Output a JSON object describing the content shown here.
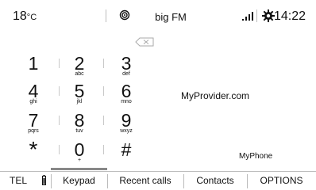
{
  "status": {
    "temperature": "18",
    "temperature_unit": "°C",
    "station": "big FM",
    "clock": "14:22",
    "icons": {
      "radio": "radio-source-icon",
      "signal": "signal-strength-icon",
      "settings": "gear-icon"
    }
  },
  "keypad": {
    "keys": [
      {
        "digit": "1",
        "letters": ""
      },
      {
        "digit": "2",
        "letters": "abc"
      },
      {
        "digit": "3",
        "letters": "def"
      },
      {
        "digit": "4",
        "letters": "ghi"
      },
      {
        "digit": "5",
        "letters": "jkl"
      },
      {
        "digit": "6",
        "letters": "mno"
      },
      {
        "digit": "7",
        "letters": "pqrs"
      },
      {
        "digit": "8",
        "letters": "tuv"
      },
      {
        "digit": "9",
        "letters": "wxyz"
      },
      {
        "digit": "*",
        "letters": ""
      },
      {
        "digit": "0",
        "letters": "+"
      },
      {
        "digit": "#",
        "letters": ""
      }
    ]
  },
  "info": {
    "provider": "MyProvider.com",
    "phone": "MyPhone"
  },
  "tabs": {
    "tel": "TEL",
    "keypad": "Keypad",
    "recent": "Recent calls",
    "contacts": "Contacts",
    "options": "OPTIONS",
    "active": "Keypad"
  },
  "colors": {
    "background": "#ffffff",
    "text": "#111111",
    "active_tab_indicator": "#888888"
  }
}
